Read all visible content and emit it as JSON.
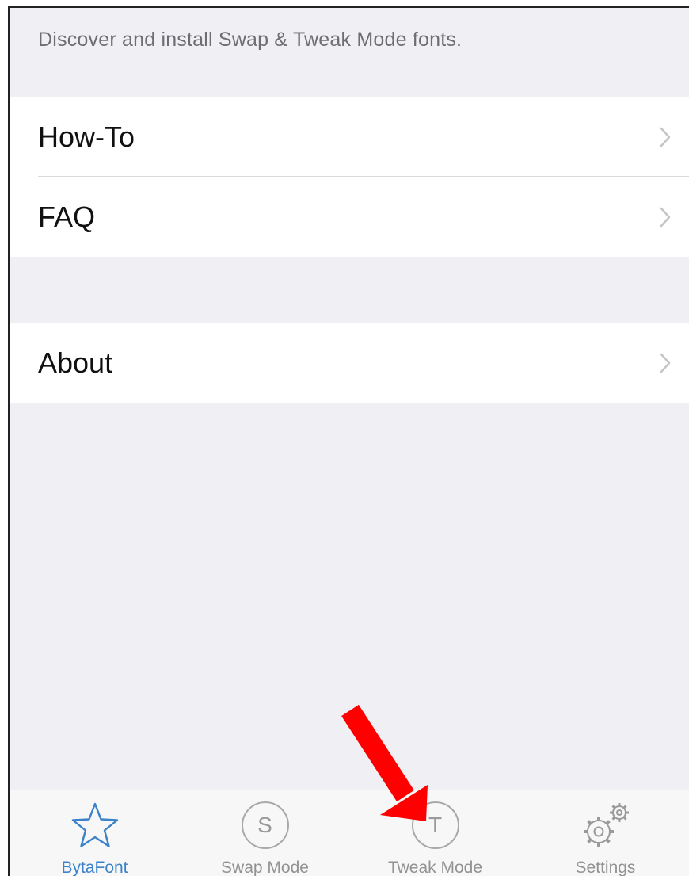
{
  "header": {
    "description": "Discover and install Swap & Tweak Mode fonts."
  },
  "menu": {
    "group1": [
      {
        "label": "How-To",
        "icon": "chevron-right-icon"
      },
      {
        "label": "FAQ",
        "icon": "chevron-right-icon"
      }
    ],
    "group2": [
      {
        "label": "About",
        "icon": "chevron-right-icon"
      }
    ]
  },
  "tabbar": {
    "tabs": [
      {
        "label": "BytaFont",
        "icon": "star-icon",
        "active": true
      },
      {
        "label": "Swap Mode",
        "icon": "circle-s-icon",
        "glyph": "S"
      },
      {
        "label": "Tweak Mode",
        "icon": "circle-t-icon",
        "glyph": "T"
      },
      {
        "label": "Settings",
        "icon": "gears-icon"
      }
    ]
  },
  "colors": {
    "accent": "#3b82c9",
    "background": "#efeff4",
    "annotation_arrow": "#ff0000"
  }
}
